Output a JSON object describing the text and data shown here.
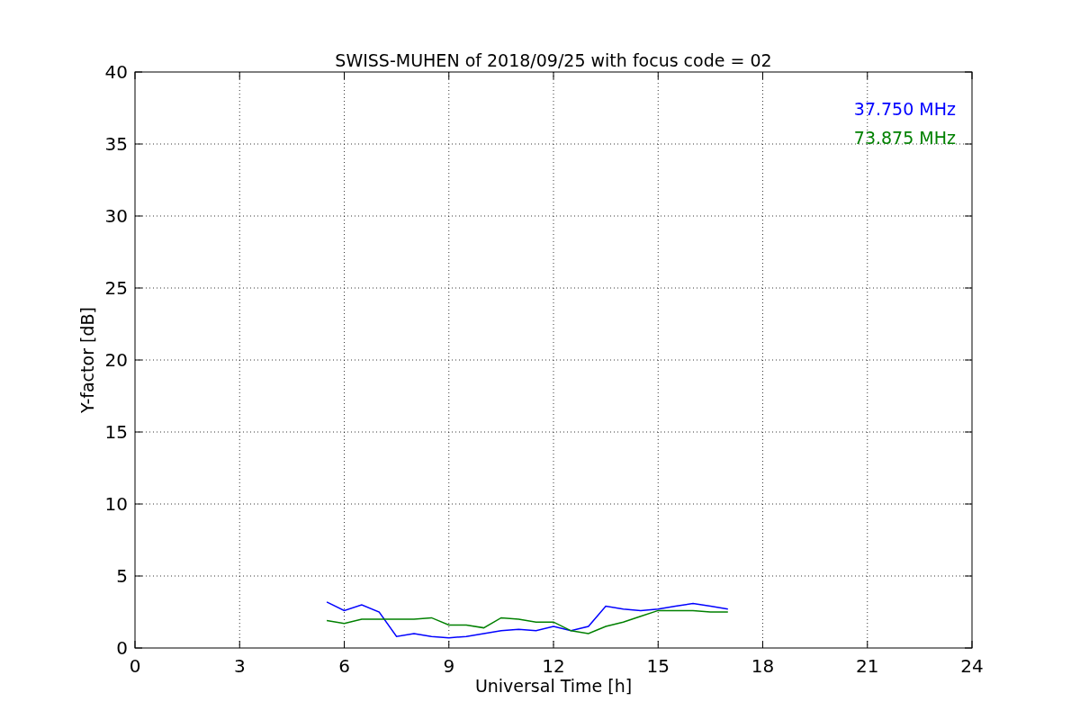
{
  "figure": {
    "chart_data": {
      "type": "line",
      "title": "SWISS-MUHEN of 2018/09/25 with focus code = 02",
      "xlabel": "Universal Time [h]",
      "ylabel": "Y-factor [dB]",
      "x": [
        5.5,
        6,
        6.5,
        7,
        7.5,
        8,
        8.5,
        9,
        9.5,
        10,
        10.5,
        11,
        11.5,
        12,
        12.5,
        13,
        13.5,
        14,
        14.5,
        15,
        15.5,
        16,
        16.5,
        17
      ],
      "series": [
        {
          "name": "37.750 MHz",
          "color": "#0000ff",
          "values": [
            3.2,
            2.6,
            3.0,
            2.5,
            0.8,
            1.0,
            0.8,
            0.7,
            0.8,
            1.0,
            1.2,
            1.3,
            1.2,
            1.5,
            1.2,
            1.5,
            2.9,
            2.7,
            2.6,
            2.7,
            2.9,
            3.1,
            2.9,
            2.7
          ]
        },
        {
          "name": "73.875 MHz",
          "color": "#008000",
          "values": [
            1.9,
            1.7,
            2.0,
            2.0,
            2.0,
            2.0,
            2.1,
            1.6,
            1.6,
            1.4,
            2.1,
            2.0,
            1.8,
            1.8,
            1.2,
            1.0,
            1.5,
            1.8,
            2.2,
            2.6,
            2.6,
            2.6,
            2.5,
            2.5
          ]
        }
      ],
      "grid": true,
      "xlim": [
        0,
        24
      ],
      "ylim": [
        0,
        40
      ],
      "xticks": [
        0,
        3,
        6,
        9,
        12,
        15,
        18,
        21,
        24
      ],
      "yticks": [
        0,
        5,
        10,
        15,
        20,
        25,
        30,
        35,
        40
      ]
    }
  }
}
